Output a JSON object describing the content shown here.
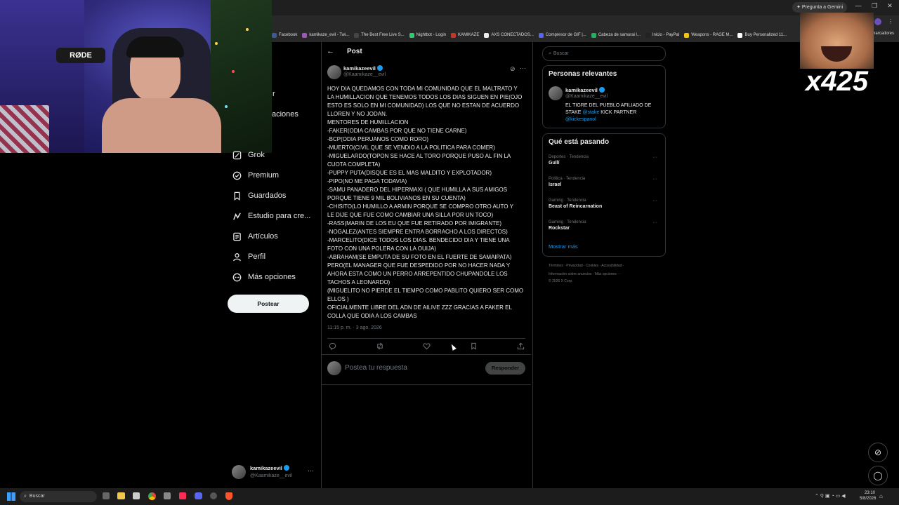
{
  "browser": {
    "gemini_label": "Pregunta a Gemini",
    "bookmarks": [
      "Facebook",
      "kamikaze_evil - Twi...",
      "The Best Free Live S...",
      "Nightbot - Login",
      "KAMIKAZE",
      "AXS CONECTADOS...",
      "Compresor de GIF |...",
      "Cabeza de samurai l...",
      "Inicio - PayPal",
      "Weapons - RAGE M...",
      "Buy Personalized 11..."
    ],
    "bookmarks_folder": "marcadores"
  },
  "webcam": {
    "mic_brand": "RØDE"
  },
  "sidebar": {
    "partial": [
      "r",
      "aciones"
    ],
    "items": [
      {
        "label": "Grok",
        "icon": "grok-icon"
      },
      {
        "label": "Premium",
        "icon": "premium-icon"
      },
      {
        "label": "Guardados",
        "icon": "bookmark-icon"
      },
      {
        "label": "Estudio para cre...",
        "icon": "studio-icon"
      },
      {
        "label": "Artículos",
        "icon": "articles-icon"
      },
      {
        "label": "Perfil",
        "icon": "profile-icon"
      },
      {
        "label": "Más opciones",
        "icon": "more-options-icon"
      }
    ],
    "post_button": "Postear",
    "account": {
      "name": "kamikazeevil",
      "handle": "@Kaamikaze__evil"
    }
  },
  "post": {
    "header": "Post",
    "author_name": "kamikazeevil",
    "author_handle": "@Kaamikaze__evil",
    "body": "HOY DIA QUEDAMOS CON TODA MI COMUNIDAD QUE EL MALTRATO Y\nLA HUMILLACION QUE TENEMOS TODOS LOS DIAS SIGUEN EN PIE(OJO\nESTO ES SOLO EN MI COMUNIDAD) LOS QUE NO ESTAN DE ACUERDO\nLLOREN Y NO JODAN.\nMENTORES DE HUMILLACION\n-FAKER(ODIA CAMBAS POR QUE NO TIENE CARNE)\n-BCP(ODIA PERUANOS COMO RORO)\n-MUERTO(CIVIL QUE SE VENDIO A LA POLITICA PARA COMER)\n-MIGUELARDO(TOPON SE HACE AL TORO PORQUE PUSO AL FIN LA\nCUOTA COMPLETA)\n-PUPPY PUTA(DISQUE ES EL MAS MALDITO Y EXPLOTADOR)\n-PIPO(NO ME PAGA TODAVIA)\n-SAMU PANADERO DEL HIPERMAXI ( QUE HUMILLA A SUS AMIGOS\nPORQUE TIENE 9 MIL BOLIVIANOS EN SU CUENTA)\n-CHISITO(LO HUMILLO A ARMIN PORQUE SE COMPRO OTRO AUTO Y\nLE DIJE QUE FUE COMO CAMBIAR UNA SILLA POR UN TOCO)\n-RASS(MARIN DE LOS EU QUE FUE RETIRADO POR IMIGRANTE)\n-NOGALEZ(ANTES SIEMPRE ENTRA BORRACHO A LOS DIRECTOS)\n-MARCELITO(DICE TODOS LOS DIAS. BENDECIDO DIA Y TIENE UNA\nFOTO CON UNA POLERA CON LA OUIJA)\n-ABRAHAM(SE EMPUTA DE SU FOTO EN EL FUERTE DE SAMAIPATA)\nPERO(EL MANAGER QUE FUE DESPEDIDO POR NO HACER NADA Y\nAHORA ESTA COMO UN PERRO ARREPENTIDO CHUPANDOLE LOS\nTACHOS A LEONARDO)\n(MIGUELITO NO PIERDE EL TIEMPO COMO PABLITO QUIERO SER COMO\nELLOS )\nOFICIALMENTE LIBRE DEL ADN DE AILIVE ZZZ GRACIAS A FAKER EL\nCOLLA QUE ODIA A LOS CAMBAS",
    "timestamp": "11:15 p. m. · 3 ago. 2026",
    "reply_placeholder": "Postea tu respuesta",
    "reply_button": "Responder"
  },
  "right": {
    "search_placeholder": "Buscar",
    "relevant": {
      "title": "Personas relevantes",
      "name": "kamikazeevil",
      "handle": "@Kaamikaze__evil",
      "bio_text": "EL TIGRE DEL PUEBLO AFILIADO DE STAKE",
      "bio_link1": "@stake",
      "bio_text2": "KICK PARTNER",
      "bio_link2": "@kickespanol"
    },
    "trends": {
      "title": "Qué está pasando",
      "items": [
        {
          "category": "Deportes · Tendencia",
          "name": "Gullí"
        },
        {
          "category": "Política · Tendencia",
          "name": "Israel"
        },
        {
          "category": "Gaming · Tendencia",
          "name": "Beast of Reincarnation"
        },
        {
          "category": "Gaming · Tendencia",
          "name": "Rockstar"
        }
      ],
      "more": "Mostrar más"
    },
    "footer": {
      "line1": "Términos · Privacidad · Cookies · Accesibilidad ·",
      "line2": "Información sobre anuncios · Más opciones ···",
      "line3": "© 2026 X Corp."
    }
  },
  "overlay": {
    "counter": "x425"
  },
  "taskbar": {
    "search_placeholder": "Buscar",
    "time": "23:10",
    "date": "5/8/2026"
  }
}
